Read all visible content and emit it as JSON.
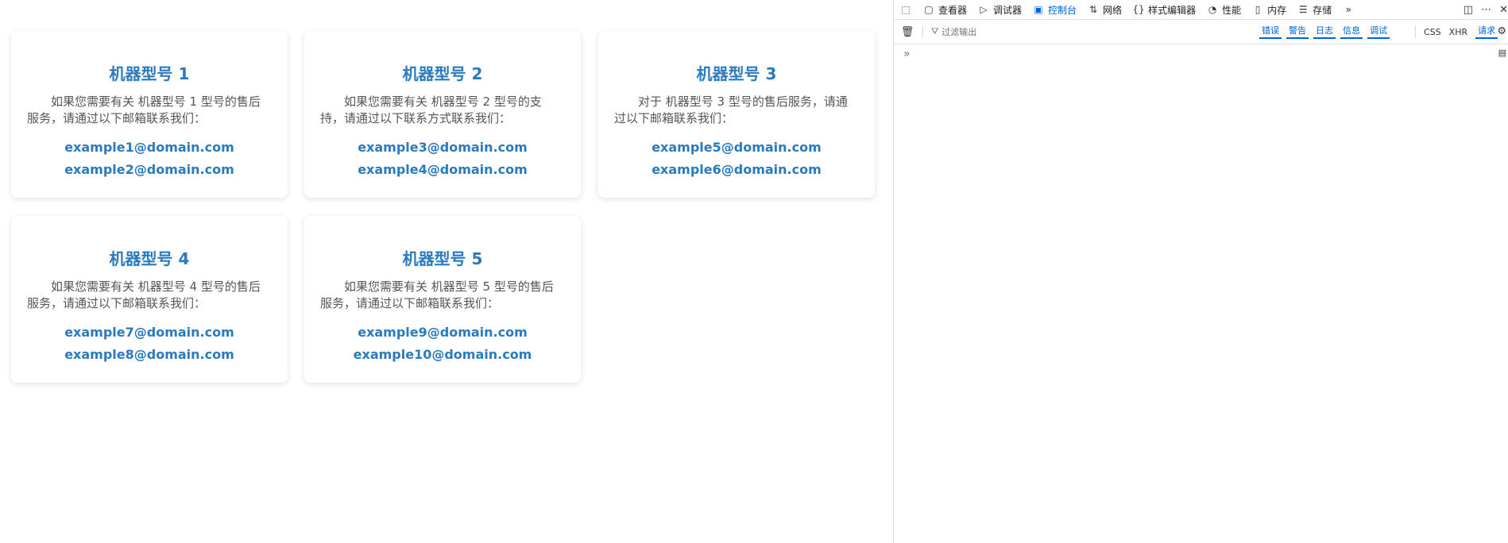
{
  "cards": [
    {
      "title": "机器型号 1",
      "desc": "如果您需要有关 机器型号 1 型号的售后服务，请通过以下邮箱联系我们：",
      "emails": [
        "example1@domain.com",
        "example2@domain.com"
      ]
    },
    {
      "title": "机器型号 2",
      "desc": "如果您需要有关 机器型号 2 型号的支持，请通过以下联系方式联系我们：",
      "emails": [
        "example3@domain.com",
        "example4@domain.com"
      ]
    },
    {
      "title": "机器型号 3",
      "desc": "对于 机器型号 3 型号的售后服务，请通过以下邮箱联系我们：",
      "emails": [
        "example5@domain.com",
        "example6@domain.com"
      ]
    },
    {
      "title": "机器型号 4",
      "desc": "如果您需要有关 机器型号 4 型号的售后服务，请通过以下邮箱联系我们：",
      "emails": [
        "example7@domain.com",
        "example8@domain.com"
      ]
    },
    {
      "title": "机器型号 5",
      "desc": "如果您需要有关 机器型号 5 型号的售后服务，请通过以下邮箱联系我们：",
      "emails": [
        "example9@domain.com",
        "example10@domain.com"
      ]
    }
  ],
  "devtools": {
    "tabs": [
      {
        "label": "查看器",
        "icon": "inspector-icon"
      },
      {
        "label": "调试器",
        "icon": "debugger-icon"
      },
      {
        "label": "控制台",
        "icon": "console-icon",
        "active": true
      },
      {
        "label": "网络",
        "icon": "network-icon"
      },
      {
        "label": "样式编辑器",
        "icon": "style-editor-icon"
      },
      {
        "label": "性能",
        "icon": "performance-icon"
      },
      {
        "label": "内存",
        "icon": "memory-icon"
      },
      {
        "label": "存储",
        "icon": "storage-icon"
      }
    ],
    "filter_placeholder": "过滤输出",
    "levels": [
      "错误",
      "警告",
      "日志",
      "信息",
      "调试"
    ],
    "categories": [
      {
        "label": "CSS",
        "on": false
      },
      {
        "label": "XHR",
        "on": false
      },
      {
        "label": "请求",
        "on": true
      }
    ],
    "prompt": "»"
  }
}
